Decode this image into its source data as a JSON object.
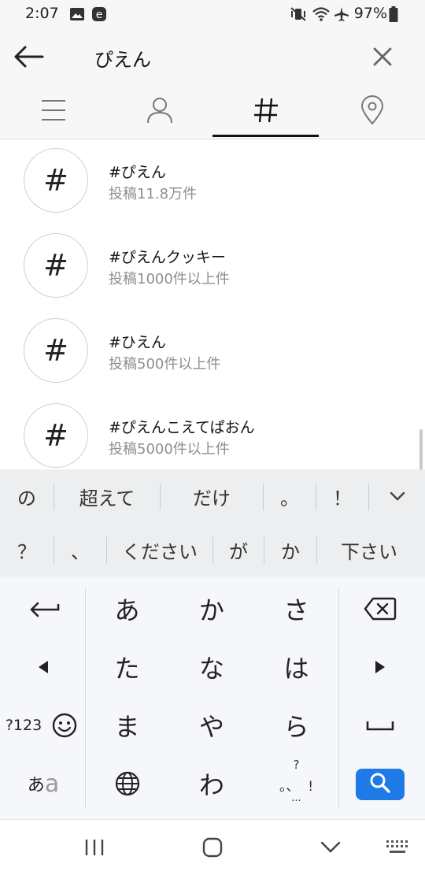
{
  "status": {
    "time": "2:07",
    "battery": "97%"
  },
  "search": {
    "query": "ぴえん"
  },
  "tabs": [
    {
      "name": "top-tab",
      "icon": "menu-lines-icon"
    },
    {
      "name": "accounts-tab",
      "icon": "person-icon"
    },
    {
      "name": "tags-tab",
      "icon": "hashtag-icon",
      "selected": true
    },
    {
      "name": "places-tab",
      "icon": "location-pin-icon"
    }
  ],
  "results": [
    {
      "symbol": "#",
      "tag": "#ぴえん",
      "count": "投稿11.8万件"
    },
    {
      "symbol": "#",
      "tag": "#ぴえんクッキー",
      "count": "投稿1000件以上件"
    },
    {
      "symbol": "#",
      "tag": "#ひえん",
      "count": "投稿500件以上件"
    },
    {
      "symbol": "#",
      "tag": "#ぴえんこえてぱおん",
      "count": "投稿5000件以上件"
    }
  ],
  "keyboard": {
    "suggestions_row1": [
      "の",
      "超えて",
      "だけ",
      "。",
      "！"
    ],
    "suggestions_row2": [
      "？",
      "、",
      "ください",
      "が",
      "か",
      "下さい"
    ],
    "kana": [
      "あ",
      "か",
      "さ",
      "た",
      "な",
      "は",
      "ま",
      "や",
      "ら",
      "わ"
    ],
    "numbers_label": "?123",
    "mode_label_a": "あ",
    "mode_label_b": "a",
    "punct_top": "?",
    "punct_mid": "。、  !",
    "punct_dots": "..."
  },
  "colors": {
    "accent": "#1e7ae6",
    "muted_text": "#8e8e8e"
  }
}
